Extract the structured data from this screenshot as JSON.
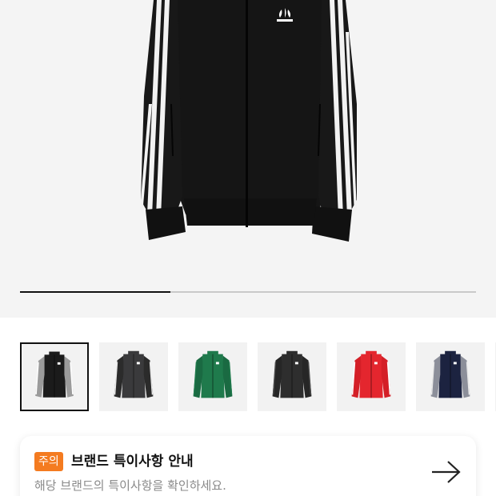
{
  "gallery": {
    "current_slide": 1,
    "total_slides": 3,
    "progress": 0.33
  },
  "thumbnails": [
    {
      "name": "thumbnail-black-white",
      "body": "#1b1b1b",
      "stripe": "#ffffff",
      "sleeve": "#9b9b9b",
      "selected": true
    },
    {
      "name": "thumbnail-charcoal-white",
      "body": "#3a3a3c",
      "stripe": "#e8e8e8",
      "sleeve": "#2b2b2b",
      "selected": false
    },
    {
      "name": "thumbnail-green",
      "body": "#1f7a4c",
      "stripe": "#1f7a4c",
      "sleeve": "#1a6a42",
      "selected": false
    },
    {
      "name": "thumbnail-dark-grey",
      "body": "#2e2e2e",
      "stripe": "#4a4a4a",
      "sleeve": "#262626",
      "selected": false
    },
    {
      "name": "thumbnail-red",
      "body": "#e4262e",
      "stripe": "#ffffff",
      "sleeve": "#d41f27",
      "selected": false
    },
    {
      "name": "thumbnail-navy-white",
      "body": "#1c2340",
      "stripe": "#e8e8e8",
      "sleeve": "#8c8f9a",
      "selected": false
    }
  ],
  "notice": {
    "badge": "주의",
    "title": "브랜드 특이사항 안내",
    "subtitle": "해당 브랜드의 특이사항을 확인하세요.",
    "arrow_icon": "arrow-right-icon",
    "badge_color": "#f47b20"
  }
}
